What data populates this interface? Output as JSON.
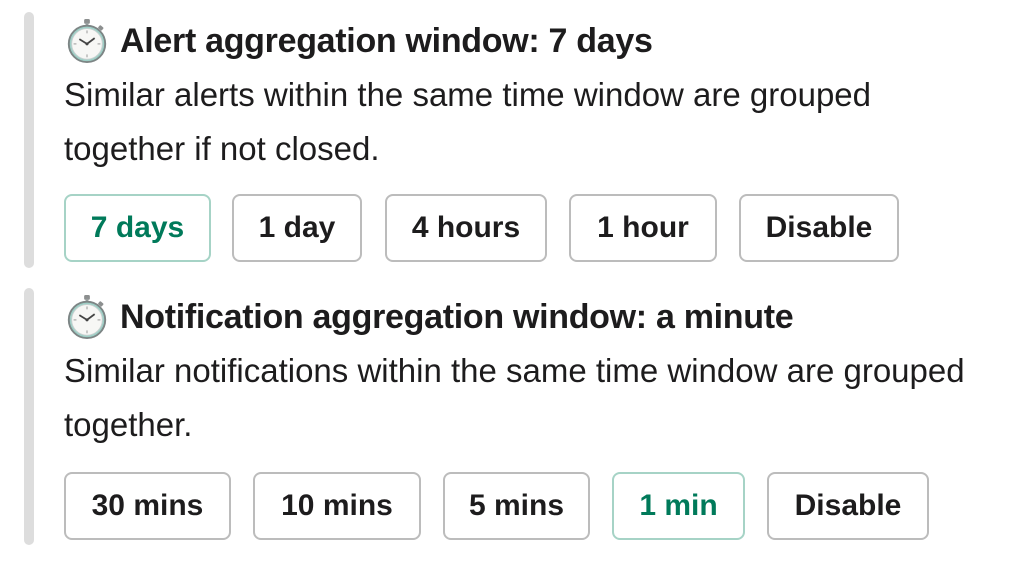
{
  "sections": [
    {
      "icon": "stopwatch-icon",
      "title": "Alert aggregation window: 7 days",
      "description": "Similar alerts within the same time window are grouped together if not closed.",
      "options": [
        {
          "label": "7 days",
          "selected": true
        },
        {
          "label": "1 day",
          "selected": false
        },
        {
          "label": "4 hours",
          "selected": false
        },
        {
          "label": "1 hour",
          "selected": false
        },
        {
          "label": "Disable",
          "selected": false
        }
      ]
    },
    {
      "icon": "stopwatch-icon",
      "title": "Notification aggregation window: a minute",
      "description": "Similar notifications within the same time window are grouped together.",
      "options": [
        {
          "label": "30 mins",
          "selected": false
        },
        {
          "label": "10 mins",
          "selected": false
        },
        {
          "label": "5 mins",
          "selected": false
        },
        {
          "label": "1 min",
          "selected": true
        },
        {
          "label": "Disable",
          "selected": false
        }
      ]
    }
  ],
  "colors": {
    "selected_text": "#007a5a",
    "selected_border": "#a6d3c6",
    "default_border": "#bcbcbc",
    "side_bar": "#dddddd"
  }
}
